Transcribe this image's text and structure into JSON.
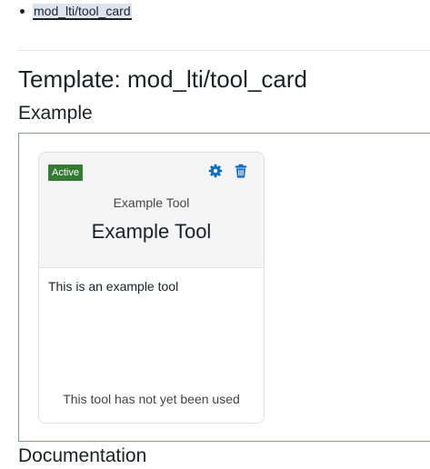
{
  "nav": {
    "items": [
      {
        "label": "mod_lti/tool_card"
      }
    ]
  },
  "page": {
    "title": "Template: mod_lti/tool_card",
    "example_heading": "Example",
    "documentation_heading": "Documentation"
  },
  "tool_card": {
    "status_badge": "Active",
    "status_color": "#357a32",
    "accent_color": "#0f6cbf",
    "icons": [
      "gear-icon",
      "trash-icon"
    ],
    "name_small": "Example Tool",
    "name_large": "Example Tool",
    "description": "This is an example tool",
    "usage": "This tool has not yet been used"
  }
}
